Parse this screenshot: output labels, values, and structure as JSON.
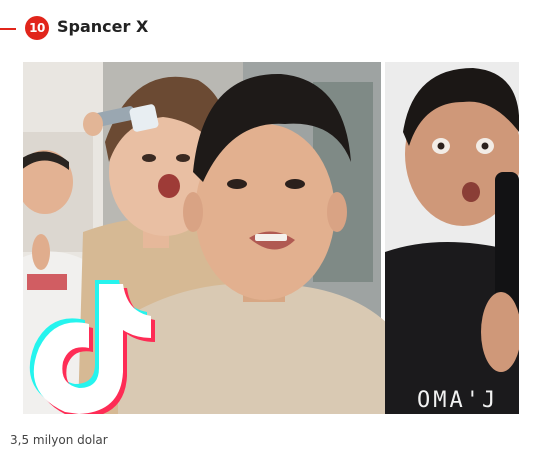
{
  "entry": {
    "rank": "10",
    "name": "Spancer X",
    "caption": "3,5 milyon dolar"
  },
  "photo": {
    "shirt_text": "OMA'J",
    "logo": "tiktok-logo-icon"
  },
  "colors": {
    "accent": "#e1251b",
    "title_text": "#222222",
    "caption_text": "#444444"
  }
}
